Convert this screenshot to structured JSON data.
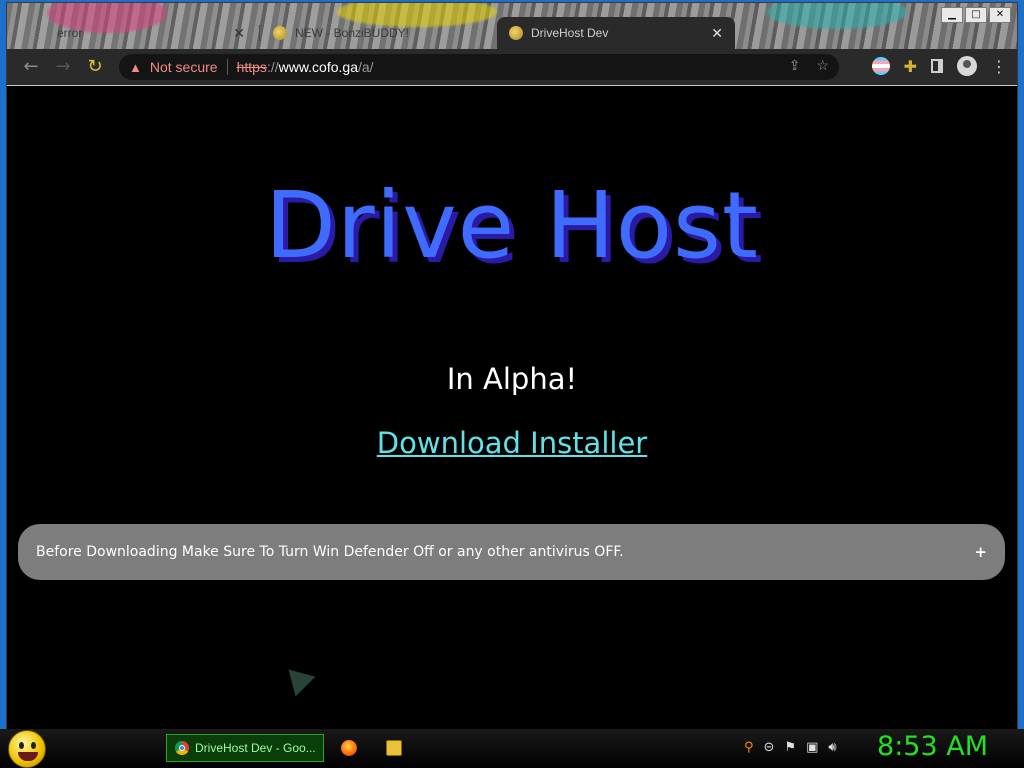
{
  "browser": {
    "tabs": [
      {
        "title": "error",
        "active": false
      },
      {
        "title": "NEW - BonziBUDDY!",
        "active": false
      },
      {
        "title": "DriveHost Dev",
        "active": true
      }
    ],
    "window_controls": {
      "minimize": "▁",
      "maximize": "□",
      "close": "✕"
    },
    "address": {
      "security_label": "Not secure",
      "scheme": "https",
      "separator": "://",
      "host": "www.cofo.ga",
      "path": "/a/"
    },
    "icons": {
      "back": "back-arrow-icon",
      "forward": "forward-arrow-icon",
      "reload": "reload-icon",
      "warning": "warning-icon",
      "share": "share-icon",
      "bookmark": "star-icon",
      "extension_flag": "trans-flag-extension-icon",
      "extensions": "puzzle-icon",
      "side_panel": "side-panel-icon",
      "profile": "avatar-icon",
      "menu": "kebab-menu-icon"
    }
  },
  "page": {
    "title": "Drive Host",
    "subtitle": "In Alpha!",
    "download_link": "Download Installer",
    "notice": {
      "text": "Before Downloading Make Sure To Turn Win Defender Off or any other antivirus OFF.",
      "expand": "+"
    }
  },
  "taskbar": {
    "active_task": "DriveHost Dev - Goo...",
    "clock": "8:53 AM"
  },
  "colors": {
    "title": "#3f6cff",
    "title_shadow": "#2a1aa6",
    "link": "#5fe3e9",
    "notice_bg": "#7d7d7d",
    "clock": "#24e024",
    "insecure": "#f28b82"
  }
}
